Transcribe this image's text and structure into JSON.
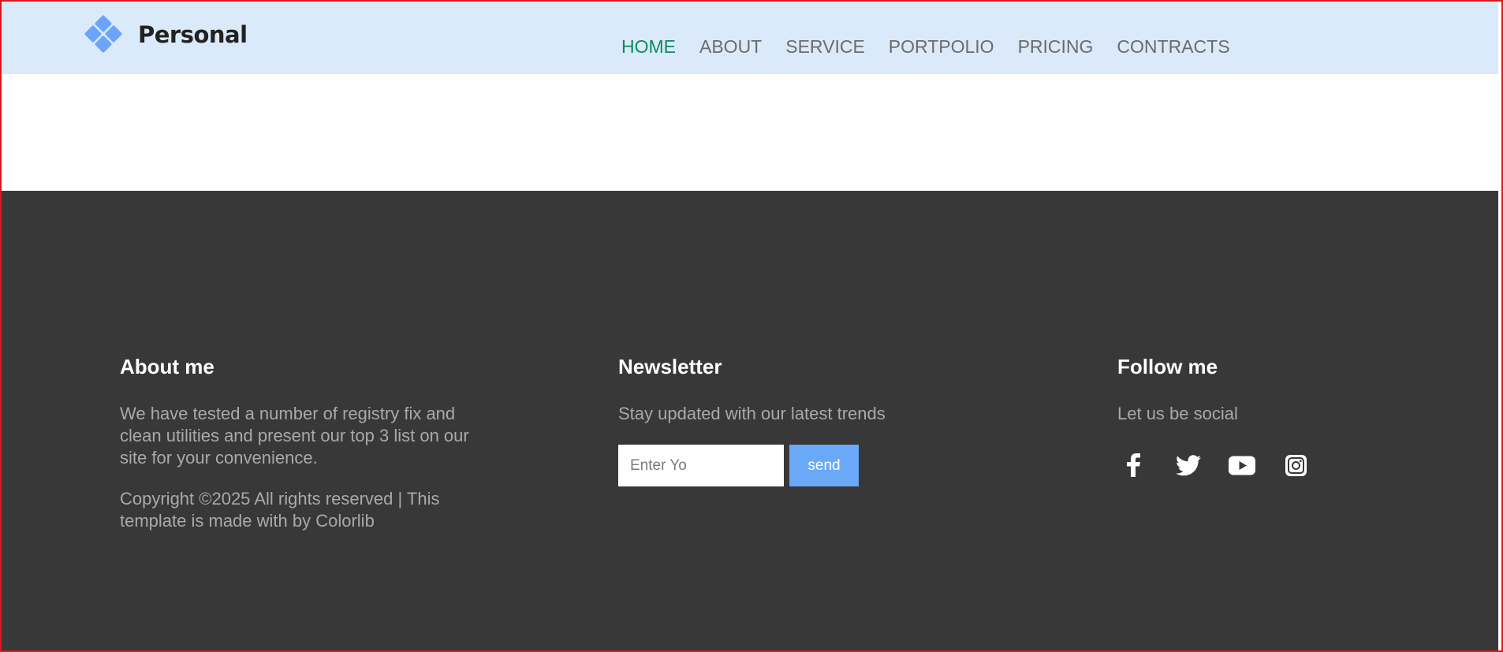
{
  "brand": {
    "name": "Personal",
    "accent_color": "#6aa5f8"
  },
  "nav": {
    "items": [
      {
        "label": "HOME",
        "active": true
      },
      {
        "label": "ABOUT",
        "active": false
      },
      {
        "label": "SERVICE",
        "active": false
      },
      {
        "label": "PORTPOLIO",
        "active": false
      },
      {
        "label": "PRICING",
        "active": false
      },
      {
        "label": "CONTRACTS",
        "active": false
      }
    ],
    "active_color": "#0e8a5c"
  },
  "footer": {
    "about": {
      "heading": "About me",
      "text": "We have tested a number of registry fix and clean utilities and present our top 3 list on our site for your convenience.",
      "copyright": "Copyright ©2025 All rights reserved | This template is made with by Colorlib"
    },
    "newsletter": {
      "heading": "Newsletter",
      "text": "Stay updated with our latest trends",
      "input_placeholder": "Enter Yo",
      "send_label": "send"
    },
    "follow": {
      "heading": "Follow me",
      "text": "Let us be social",
      "socials": [
        "facebook-icon",
        "twitter-icon",
        "youtube-icon",
        "instagram-icon"
      ]
    }
  }
}
